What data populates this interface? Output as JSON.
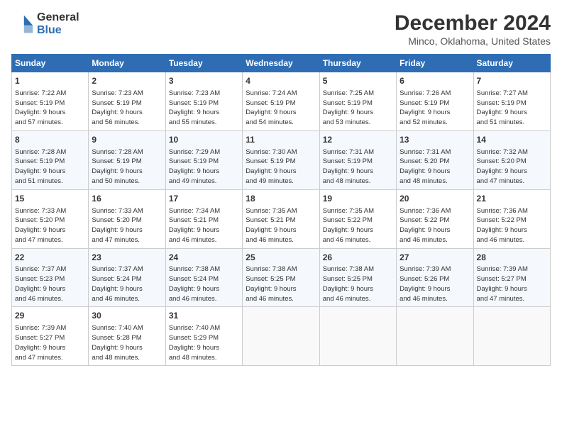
{
  "logo": {
    "general": "General",
    "blue": "Blue"
  },
  "title": "December 2024",
  "subtitle": "Minco, Oklahoma, United States",
  "headers": [
    "Sunday",
    "Monday",
    "Tuesday",
    "Wednesday",
    "Thursday",
    "Friday",
    "Saturday"
  ],
  "weeks": [
    [
      {
        "day": "1",
        "info": "Sunrise: 7:22 AM\nSunset: 5:19 PM\nDaylight: 9 hours\nand 57 minutes."
      },
      {
        "day": "2",
        "info": "Sunrise: 7:23 AM\nSunset: 5:19 PM\nDaylight: 9 hours\nand 56 minutes."
      },
      {
        "day": "3",
        "info": "Sunrise: 7:23 AM\nSunset: 5:19 PM\nDaylight: 9 hours\nand 55 minutes."
      },
      {
        "day": "4",
        "info": "Sunrise: 7:24 AM\nSunset: 5:19 PM\nDaylight: 9 hours\nand 54 minutes."
      },
      {
        "day": "5",
        "info": "Sunrise: 7:25 AM\nSunset: 5:19 PM\nDaylight: 9 hours\nand 53 minutes."
      },
      {
        "day": "6",
        "info": "Sunrise: 7:26 AM\nSunset: 5:19 PM\nDaylight: 9 hours\nand 52 minutes."
      },
      {
        "day": "7",
        "info": "Sunrise: 7:27 AM\nSunset: 5:19 PM\nDaylight: 9 hours\nand 51 minutes."
      }
    ],
    [
      {
        "day": "8",
        "info": "Sunrise: 7:28 AM\nSunset: 5:19 PM\nDaylight: 9 hours\nand 51 minutes."
      },
      {
        "day": "9",
        "info": "Sunrise: 7:28 AM\nSunset: 5:19 PM\nDaylight: 9 hours\nand 50 minutes."
      },
      {
        "day": "10",
        "info": "Sunrise: 7:29 AM\nSunset: 5:19 PM\nDaylight: 9 hours\nand 49 minutes."
      },
      {
        "day": "11",
        "info": "Sunrise: 7:30 AM\nSunset: 5:19 PM\nDaylight: 9 hours\nand 49 minutes."
      },
      {
        "day": "12",
        "info": "Sunrise: 7:31 AM\nSunset: 5:19 PM\nDaylight: 9 hours\nand 48 minutes."
      },
      {
        "day": "13",
        "info": "Sunrise: 7:31 AM\nSunset: 5:20 PM\nDaylight: 9 hours\nand 48 minutes."
      },
      {
        "day": "14",
        "info": "Sunrise: 7:32 AM\nSunset: 5:20 PM\nDaylight: 9 hours\nand 47 minutes."
      }
    ],
    [
      {
        "day": "15",
        "info": "Sunrise: 7:33 AM\nSunset: 5:20 PM\nDaylight: 9 hours\nand 47 minutes."
      },
      {
        "day": "16",
        "info": "Sunrise: 7:33 AM\nSunset: 5:20 PM\nDaylight: 9 hours\nand 47 minutes."
      },
      {
        "day": "17",
        "info": "Sunrise: 7:34 AM\nSunset: 5:21 PM\nDaylight: 9 hours\nand 46 minutes."
      },
      {
        "day": "18",
        "info": "Sunrise: 7:35 AM\nSunset: 5:21 PM\nDaylight: 9 hours\nand 46 minutes."
      },
      {
        "day": "19",
        "info": "Sunrise: 7:35 AM\nSunset: 5:22 PM\nDaylight: 9 hours\nand 46 minutes."
      },
      {
        "day": "20",
        "info": "Sunrise: 7:36 AM\nSunset: 5:22 PM\nDaylight: 9 hours\nand 46 minutes."
      },
      {
        "day": "21",
        "info": "Sunrise: 7:36 AM\nSunset: 5:22 PM\nDaylight: 9 hours\nand 46 minutes."
      }
    ],
    [
      {
        "day": "22",
        "info": "Sunrise: 7:37 AM\nSunset: 5:23 PM\nDaylight: 9 hours\nand 46 minutes."
      },
      {
        "day": "23",
        "info": "Sunrise: 7:37 AM\nSunset: 5:24 PM\nDaylight: 9 hours\nand 46 minutes."
      },
      {
        "day": "24",
        "info": "Sunrise: 7:38 AM\nSunset: 5:24 PM\nDaylight: 9 hours\nand 46 minutes."
      },
      {
        "day": "25",
        "info": "Sunrise: 7:38 AM\nSunset: 5:25 PM\nDaylight: 9 hours\nand 46 minutes."
      },
      {
        "day": "26",
        "info": "Sunrise: 7:38 AM\nSunset: 5:25 PM\nDaylight: 9 hours\nand 46 minutes."
      },
      {
        "day": "27",
        "info": "Sunrise: 7:39 AM\nSunset: 5:26 PM\nDaylight: 9 hours\nand 46 minutes."
      },
      {
        "day": "28",
        "info": "Sunrise: 7:39 AM\nSunset: 5:27 PM\nDaylight: 9 hours\nand 47 minutes."
      }
    ],
    [
      {
        "day": "29",
        "info": "Sunrise: 7:39 AM\nSunset: 5:27 PM\nDaylight: 9 hours\nand 47 minutes."
      },
      {
        "day": "30",
        "info": "Sunrise: 7:40 AM\nSunset: 5:28 PM\nDaylight: 9 hours\nand 48 minutes."
      },
      {
        "day": "31",
        "info": "Sunrise: 7:40 AM\nSunset: 5:29 PM\nDaylight: 9 hours\nand 48 minutes."
      },
      {
        "day": "",
        "info": ""
      },
      {
        "day": "",
        "info": ""
      },
      {
        "day": "",
        "info": ""
      },
      {
        "day": "",
        "info": ""
      }
    ]
  ]
}
